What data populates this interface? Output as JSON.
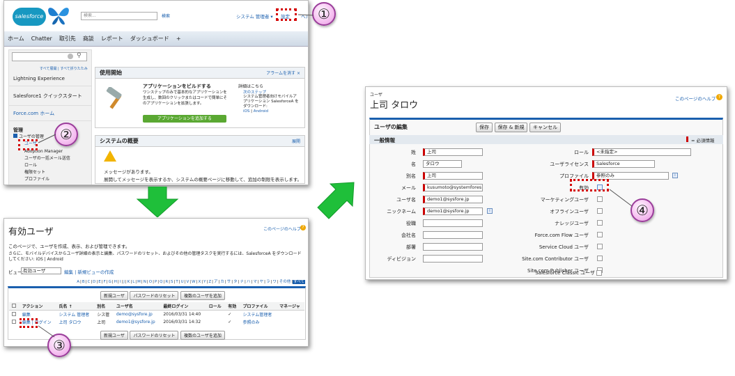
{
  "panel1": {
    "logo": "salesforce",
    "search_placeholder": "検索...",
    "search_button": "検索",
    "user_menu": "システム 管理者 ▾",
    "setup_link": "設定",
    "help_link": "ヘルプ",
    "tabs": [
      "ホーム",
      "Chatter",
      "取引先",
      "商談",
      "レポート",
      "ダッシュボード",
      "+"
    ],
    "side_search_placeholder": "",
    "expand_links": "すべて展開 | すべて折りたたみ",
    "side_items": [
      "Lightning Experience",
      "Salesforce1 クイックスタート",
      "Force.com ホーム"
    ],
    "admin_header": "管理",
    "user_mgmt": "ユーザの管理",
    "user_mgmt_subitems": [
      "ユーザ",
      "Adoption Manager",
      "ユーザの一括メール送信",
      "ロール",
      "権限セット",
      "プロファイル"
    ],
    "getting_started": {
      "title": "使用開始",
      "dismiss": "アラームを消す ×",
      "app_title": "アプリケーションをビルドする",
      "app_desc": "ワンステップのみで基本的なアプリケーションを生成し、数回のクリックまたはコードで簡単にそのアプリケーションを拡張します。",
      "add_app_button": "アプリケーションを追加する",
      "details_title": "詳細はこちら",
      "next_step": "次のステップ",
      "mobile_text": "システム管理者向けモバイルアプリケーション SalesforceA をダウンロード:",
      "ios": "iOS",
      "android": "Android"
    },
    "overview": {
      "title": "システムの概要",
      "expand": "展開",
      "message_title": "メッセージがあります。",
      "message_body": "展開してメッセージを表示するか、システムの概要ページに移動して、追加の制限を表示します。"
    }
  },
  "panel2": {
    "title": "有効ユーザ",
    "help": "このページのヘルプ",
    "desc1": "このページで、ユーザを作成、表示、および管理できます。",
    "desc2": "さらに、モバイルデバイスからユーザ詳細の表示と編集、パスワードのリセット、およびその他の管理タスクを実行するには、SalesforceA をダウンロードしてください: iOS | Android",
    "view_label": "ビュー:",
    "view_select": "有効ユーザ",
    "view_links": "編集 | 新規ビューの作成",
    "alpha": [
      "A",
      "B",
      "C",
      "D",
      "E",
      "F",
      "G",
      "H",
      "I",
      "J",
      "K",
      "L",
      "M",
      "N",
      "O",
      "P",
      "Q",
      "R",
      "S",
      "T",
      "U",
      "V",
      "W",
      "X",
      "Y",
      "Z",
      "ア",
      "カ",
      "サ",
      "タ",
      "ナ",
      "ハ",
      "マ",
      "ヤ",
      "ラ",
      "ワ",
      "その他",
      "すべて"
    ],
    "buttons": [
      "新規ユーザ",
      "パスワードのリセット",
      "複数のユーザを追加"
    ],
    "columns": [
      "アクション",
      "氏名 ↑",
      "別名",
      "ユーザ名",
      "最終ログイン",
      "ロール",
      "有効",
      "プロファイル",
      "マネージャ"
    ],
    "rows": [
      [
        "編集",
        "システム 管理者",
        "シス管",
        "demo@sysfore.jp",
        "2016/03/31 14:40",
        "",
        "✓",
        "システム管理者",
        ""
      ],
      [
        "編集 | ログイン",
        "上司 タロウ",
        "上司",
        "demo1@sysfore.jp",
        "2016/03/31 14:32",
        "",
        "✓",
        "参照のみ",
        ""
      ]
    ]
  },
  "panel3": {
    "object_label": "ユーザ",
    "title": "上司 タロウ",
    "help": "このページのヘルプ",
    "section_title": "ユーザの編集",
    "buttons": [
      "保存",
      "保存 & 新規",
      "キャンセル"
    ],
    "info_title": "一般情報",
    "required_note": "= 必須情報",
    "left_fields": [
      {
        "label": "姓",
        "value": "上司",
        "req": true
      },
      {
        "label": "名",
        "value": "タロウ",
        "req": false
      },
      {
        "label": "別名",
        "value": "上司",
        "req": true
      },
      {
        "label": "メール",
        "value": "kusumoto@systemfores",
        "req": true
      },
      {
        "label": "ユーザ名",
        "value": "demo1@sysfore.jp",
        "req": true
      },
      {
        "label": "ニックネーム",
        "value": "demo1@sysfore.jp",
        "req": true
      },
      {
        "label": "役職",
        "value": "",
        "req": false
      },
      {
        "label": "会社名",
        "value": "",
        "req": false
      },
      {
        "label": "部署",
        "value": "",
        "req": false
      },
      {
        "label": "ディビジョン",
        "value": "",
        "req": false
      }
    ],
    "role_label": "ロール",
    "role_value": "<未指定>",
    "license_label": "ユーザライセンス",
    "license_value": "Salesforce",
    "profile_label": "プロファイル",
    "profile_value": "参照のみ",
    "checkbox_labels": [
      "有効",
      "マーケティングユーザ",
      "オフラインユーザ",
      "ナレッジユーザ",
      "Force.com Flow ユーザ",
      "Service Cloud ユーザ",
      "Site.com Contributor ユーザ",
      "Site.com Publisher ユーザ",
      "Salesforce Classic ユーザ"
    ]
  },
  "badges": [
    "①",
    "②",
    "③",
    "④"
  ],
  "colors": {
    "arrow": "#1fbf3a",
    "badge": "#f5bff0",
    "dash": "#d40000",
    "accent": "#1a5fae"
  }
}
